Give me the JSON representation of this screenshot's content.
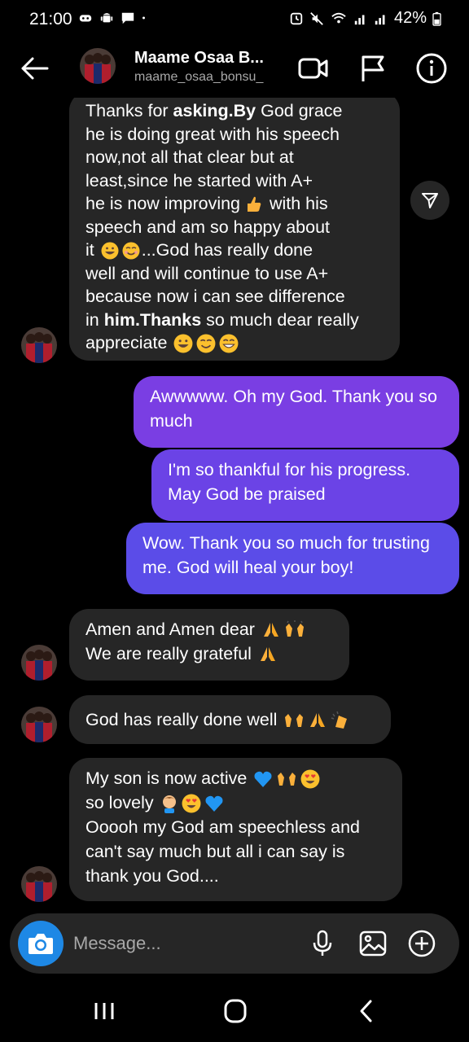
{
  "status": {
    "time": "21:00",
    "battery": "42%"
  },
  "header": {
    "name": "Maame Osaa B...",
    "handle": "maame_osaa_bonsu_",
    "icons": [
      "back-arrow-icon",
      "video-call-icon",
      "flag-icon",
      "info-icon"
    ]
  },
  "messages": {
    "m1": {
      "l1_pre": "Thanks for ",
      "l1_bold": "asking.By",
      "l1_post": " God grace",
      "l2": "he is doing great with his speech",
      "l3": "now,not all that clear but at",
      "l4": "least,since he started with A+",
      "l5_pre": "he is now improving ",
      "l5_post": " with his",
      "l6": "speech and am so happy about",
      "l7_pre": "it ",
      "l7_post": "...God has really done",
      "l8": "well and will continue to use A+",
      "l9": "because now i can see difference",
      "l10_pre": "in ",
      "l10_bold": "him.Thanks",
      "l10_post": " so much dear really",
      "l11": "appreciate "
    },
    "m2": "Awwwww. Oh my God. Thank you so much",
    "m3": "I'm so thankful for his progress. May God be praised",
    "m4": "Wow. Thank you so much for trusting me. God will heal your boy!",
    "m5": {
      "l1": "Amen and Amen dear ",
      "l2": "We are really grateful "
    },
    "m6": "God has really done well ",
    "m7": {
      "l1": "My son is now active ",
      "l2": " so lovely ",
      "l3": "Ooooh my God am speechless and",
      "l4": "can't say much but all i can say is",
      "l5": "thank you God...."
    }
  },
  "composer": {
    "placeholder": "Message..."
  },
  "colors": {
    "incoming_bubble": "#262626",
    "outgoing_top": "#7b3fe4",
    "outgoing_bottom": "#5a4ee8",
    "camera_button": "#1e88e5",
    "background": "#000000"
  }
}
